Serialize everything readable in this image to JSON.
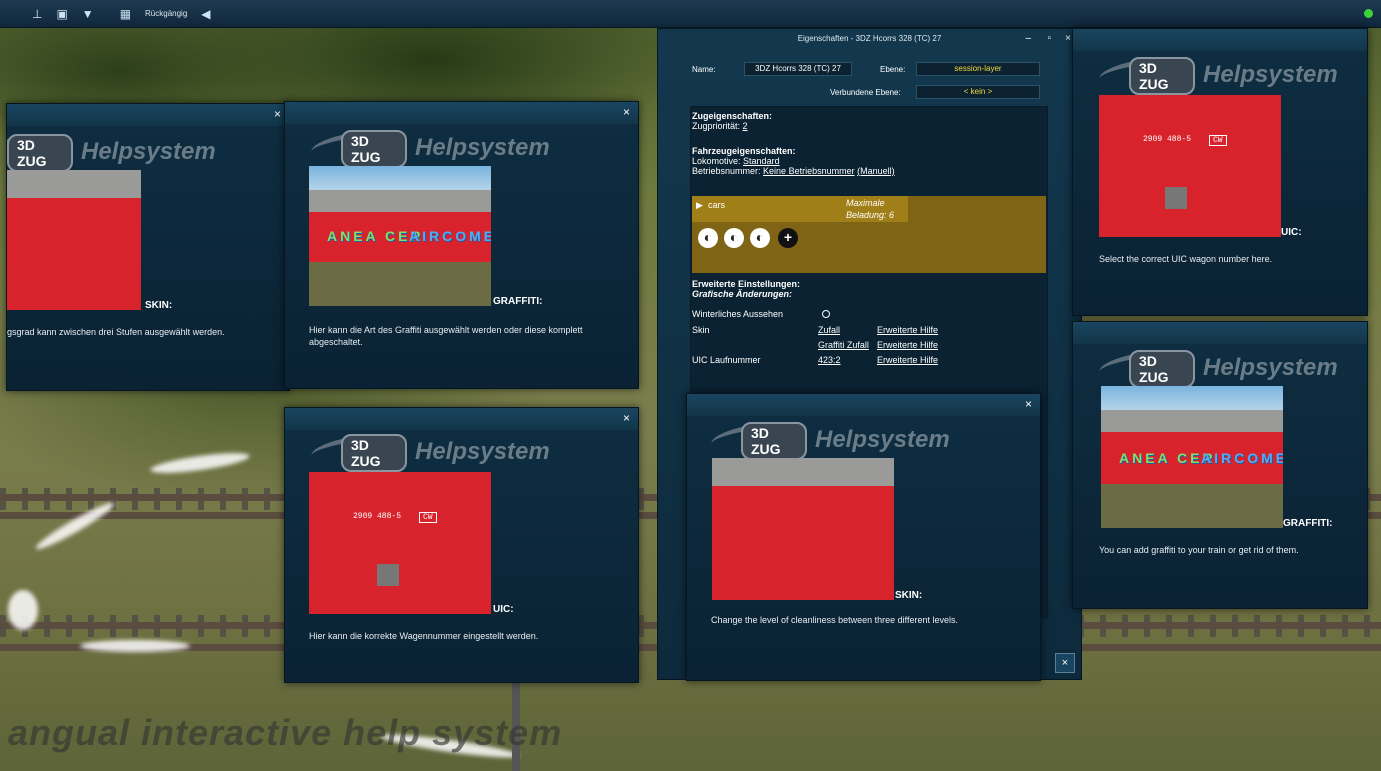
{
  "toolbar": {
    "undo_label": "Rückgängig",
    "icons": [
      "marker-icon",
      "edit-icon",
      "filter-icon",
      "grid-icon",
      "arrow-left-icon"
    ],
    "status_color": "#3fd13a"
  },
  "watermark": "angual interactive help system",
  "logo": {
    "brand": "ZUG",
    "brand_prefix": "3D",
    "help": "Helpsystem"
  },
  "panels": {
    "skin_de": {
      "caption": "SKIN:",
      "text": "gsgrad kann zwischen drei Stufen ausgewählt werden."
    },
    "graffiti_de": {
      "caption": "GRAFFITI:",
      "text": "Hier kann die Art des Graffiti ausgewählt werden oder diese komplett abgeschaltet."
    },
    "uic_de": {
      "caption": "UIC:",
      "text": "Hier kann die korrekte Wagennummer eingestellt werden."
    },
    "skin_en": {
      "caption": "SKIN:",
      "text": "Change the level of cleanliness between three different levels."
    },
    "uic_en": {
      "caption": "UIC:",
      "text": "Select the correct UIC wagon number here."
    },
    "graffiti_en": {
      "caption": "GRAFFITI:",
      "text": "You can add graffiti to your train or get rid of them."
    },
    "wagon_number": "2909 488-5",
    "wagon_tag": "CW",
    "graffiti_text_1": "ANEA CER",
    "graffiti_text_2": "AIRCOME"
  },
  "props": {
    "title": "Eigenschaften - 3DZ Hcorrs 328 (TC) 27",
    "name_label": "Name:",
    "name_value": "3DZ Hcorrs 328 (TC) 27",
    "layer_label": "Ebene:",
    "layer_value": "session-layer",
    "linked_layer_label": "Verbundene Ebene:",
    "linked_layer_value": "< kein >",
    "train_props_heading": "Zugeigenschaften:",
    "train_priority_label": "Zugpriorität:",
    "train_priority_value": "2",
    "vehicle_props_heading": "Fahrzeugeigenschaften:",
    "loco_label": "Lokomotive:",
    "loco_value": "Standard",
    "number_label": "Betriebsnummer:",
    "number_value": "Keine Betriebsnummer",
    "number_manual": "(Manuell)",
    "cars_label": "cars",
    "max_load_label": "Maximale",
    "load_label": "Beladung: 6",
    "advanced_heading": "Erweiterte Einstellungen:",
    "graphic_heading": "Grafische Änderungen:",
    "winter_label": "Winterliches Aussehen",
    "skin_label": "Skin",
    "skin_value": "Zufall",
    "skin_help": "Erweiterte Hilfe",
    "graffiti_value": "Graffiti Zufall",
    "graffiti_help": "Erweiterte Hilfe",
    "uic_label": "UIC Laufnummer",
    "uic_value": "423:2",
    "uic_help": "Erweiterte Hilfe"
  }
}
